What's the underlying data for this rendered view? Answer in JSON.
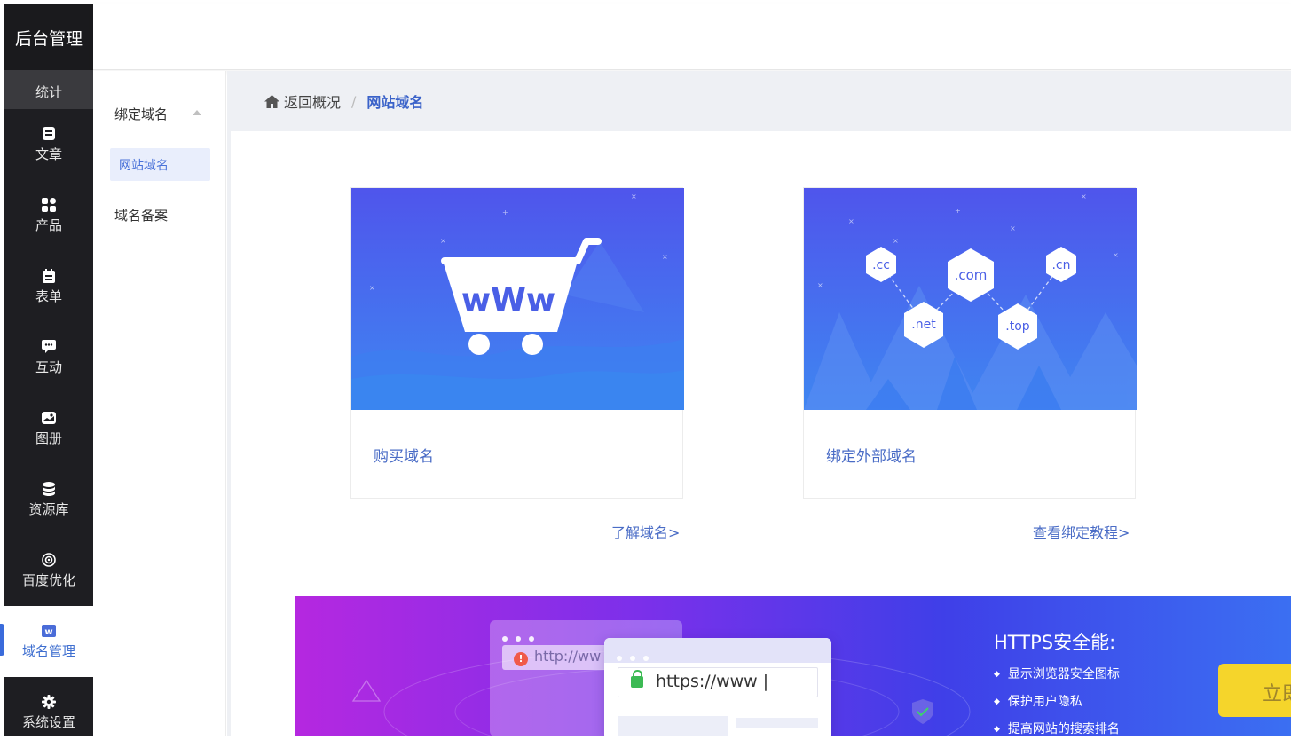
{
  "sidebar": {
    "logo": "后台管理",
    "items": [
      {
        "label": "统计",
        "icon": "chart-icon"
      },
      {
        "label": "文章",
        "icon": "article-icon"
      },
      {
        "label": "产品",
        "icon": "grid-icon"
      },
      {
        "label": "表单",
        "icon": "form-icon"
      },
      {
        "label": "互动",
        "icon": "chat-icon"
      },
      {
        "label": "图册",
        "icon": "gallery-icon"
      },
      {
        "label": "资源库",
        "icon": "database-icon"
      },
      {
        "label": "百度优化",
        "icon": "target-icon"
      },
      {
        "label": "域名管理",
        "icon": "domain-w-icon"
      },
      {
        "label": "系统设置",
        "icon": "gear-icon"
      }
    ],
    "active_index": 8
  },
  "subnav": {
    "group": "绑定域名",
    "active_item": "网站域名",
    "item": "域名备案"
  },
  "breadcrumb": {
    "back": "返回概况",
    "separator": "/",
    "current": "网站域名"
  },
  "cards": {
    "buy": {
      "caption": "购买域名",
      "link": "了解域名>",
      "art_text": "wWw"
    },
    "bind": {
      "caption": "绑定外部域名",
      "link": "查看绑定教程>",
      "tlds": [
        ".cc",
        ".com",
        ".cn",
        ".net",
        ".top"
      ]
    }
  },
  "banner": {
    "old_url": "http://ww",
    "new_url": "https://www |",
    "title": "HTTPS安全能:",
    "features": [
      "显示浏览器安全图标",
      "保护用户隐私",
      "提高网站的搜索排名"
    ],
    "cta": "立即"
  },
  "colors": {
    "accent": "#3a62c9",
    "sidebar_bg": "#1e1e22",
    "cta_bg": "#f5d52b"
  }
}
